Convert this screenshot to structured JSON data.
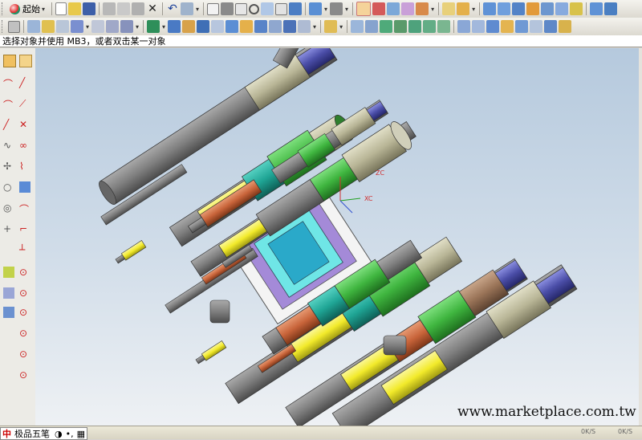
{
  "toolbar": {
    "start_label": "起始"
  },
  "status_bar": {
    "prompt": "选择对象并使用 MB3，或者双击某一对象"
  },
  "viewport": {
    "axis_labels": {
      "z": "ZC",
      "x": "XC"
    },
    "watermark": "www.marketplace.com.tw"
  },
  "taskbar": {
    "ime_label": "极品五笔",
    "ime_icon_label": "中",
    "status_right_1": "0K/S",
    "status_right_2": "0K/S"
  },
  "colors": {
    "viewport_top": "#b5c9dd",
    "viewport_bottom": "#eef1f4",
    "tube_gray": "#7f7f7f",
    "tube_green": "#3fb53f",
    "tube_teal": "#1fa595",
    "tube_yellow": "#f2ea2a",
    "tube_orange": "#c8643a",
    "tube_tan": "#b8b596",
    "tube_blue": "#4b4ea8",
    "plate_cyan": "#6fe6e6",
    "plate_purple": "#a48ad8"
  }
}
